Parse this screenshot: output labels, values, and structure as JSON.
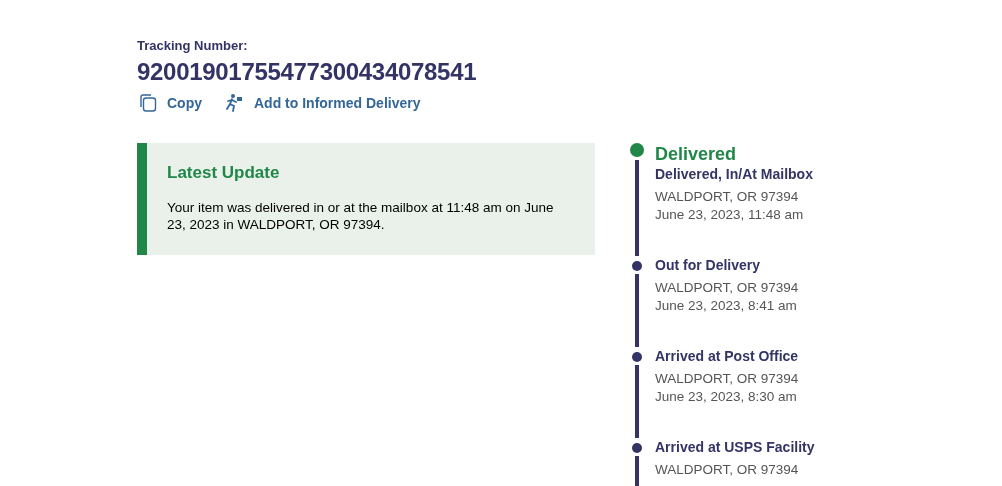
{
  "tracking": {
    "label": "Tracking Number:",
    "number": "92001901755477300434078541"
  },
  "actions": [
    {
      "kind": "copy",
      "label": "Copy"
    },
    {
      "kind": "informed",
      "label": "Add to Informed Delivery"
    }
  ],
  "latest_update": {
    "title": "Latest Update",
    "text": "Your item was delivered in or at the mailbox at 11:48 am on June 23, 2023 in WALDPORT, OR 97394."
  },
  "timeline": [
    {
      "kind": "current",
      "status": "Delivered",
      "event": "Delivered, In/At Mailbox",
      "location": "WALDPORT, OR 97394",
      "datetime": "June 23, 2023, 11:48 am"
    },
    {
      "kind": "past",
      "event": "Out for Delivery",
      "location": "WALDPORT, OR 97394",
      "datetime": "June 23, 2023, 8:41 am"
    },
    {
      "kind": "past",
      "event": "Arrived at Post Office",
      "location": "WALDPORT, OR 97394",
      "datetime": "June 23, 2023, 8:30 am"
    },
    {
      "kind": "past",
      "event": "Arrived at USPS Facility",
      "location": "WALDPORT, OR 97394"
    }
  ]
}
